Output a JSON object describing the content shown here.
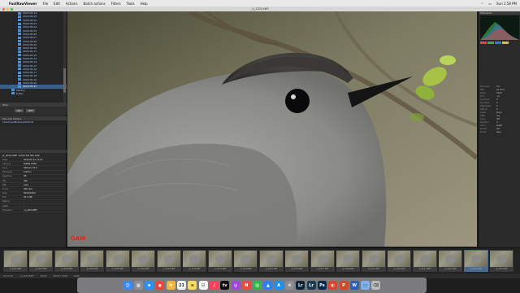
{
  "menubar": {
    "app": "FastRawViewer",
    "items": [
      "File",
      "Edit",
      "Actions",
      "Batch actions",
      "Filters",
      "Tools",
      "Help"
    ],
    "clock": "Sun 1:58 PM"
  },
  "window": {
    "title": "_II_2023.NEF"
  },
  "left_panel": {
    "folders": [
      "2020.04.14",
      "2020.04.18",
      "2020.05.02",
      "2020.05.03",
      "2020.05.04",
      "2020.05.05",
      "2020.05.06",
      "2020.05.07",
      "2020.05.08",
      "2020.05.09",
      "2020.05.10",
      "2020.05.11",
      "2020.05.12",
      "2020.05.13",
      "2020.05.14",
      "2020.05.15",
      "2020.05.16",
      "2020.05.17",
      "2020.05.18",
      "2020.05.19",
      "2020.05.20"
    ],
    "selected_folder": "2020.05.31",
    "libraries": [
      "Library",
      "Public"
    ],
    "strip_label": "Filter",
    "filter_buttons": [
      "ON",
      "OFF"
    ],
    "favorites_title": "Favorite folders",
    "favorite": "/Volumes/Photos/2020.05",
    "info_title": "_II_2023.NEF  1/250 f/8  ISO 400",
    "info_rows": [
      {
        "k": "Date",
        "v": "2020-05-31 13:22"
      },
      {
        "k": "Camera",
        "v": "NIKON D850"
      },
      {
        "k": "Lens",
        "v": "500mm f/5.6"
      },
      {
        "k": "Exposure",
        "v": "1/250 s"
      },
      {
        "k": "Aperture",
        "v": "f/8"
      },
      {
        "k": "ISO",
        "v": "400"
      },
      {
        "k": "WB",
        "v": "Auto"
      },
      {
        "k": "Focal",
        "v": "500 mm"
      },
      {
        "k": "Size",
        "v": "8256x5504"
      },
      {
        "k": "File",
        "v": "45.2 MB"
      },
      {
        "k": "Rating",
        "v": "-"
      },
      {
        "k": "Label",
        "v": "-"
      },
      {
        "k": "Filename",
        "v": "_II_2023.NEF"
      }
    ]
  },
  "viewer": {
    "watermark": "GAW"
  },
  "right_panel": {
    "hist_title": "Histogram",
    "meta": [
      {
        "k": "Exposure",
        "v": "0.0"
      },
      {
        "k": "WB",
        "v": "As Shot"
      },
      {
        "k": "Temp",
        "v": "5200"
      },
      {
        "k": "Tint",
        "v": "+4"
      },
      {
        "k": "Contrast",
        "v": "0"
      },
      {
        "k": "Shadows",
        "v": "0"
      },
      {
        "k": "Highlights",
        "v": "0"
      },
      {
        "k": "Rating",
        "v": "0"
      },
      {
        "k": "Label",
        "v": "None"
      },
      {
        "k": "XMP",
        "v": "Yes"
      },
      {
        "k": "Crop",
        "v": "Off"
      },
      {
        "k": "Rotation",
        "v": "0"
      },
      {
        "k": "Color",
        "v": "sRGB"
      },
      {
        "k": "Profile",
        "v": "Std"
      },
      {
        "k": "Mode",
        "v": "Raw"
      }
    ],
    "colors": [
      "#e04b3f",
      "#3fb049",
      "#3a74d8",
      "#d6c13a"
    ]
  },
  "filmstrip": {
    "thumbs": [
      "_II_2002.NEF",
      "_II_2003.NEF",
      "_II_2005.NEF",
      "_II_2006.NEF",
      "_II_2008.NEF",
      "_II_2009.NEF",
      "_II_2010.NEF",
      "_II_2012.NEF",
      "_II_2013.NEF",
      "_II_2014.NEF",
      "_II_2015.NEF",
      "_II_2016.NEF",
      "_II_2017.NEF",
      "_II_2018.NEF",
      "_II_2019.NEF",
      "_II_2020.NEF",
      "_II_2021.NEF",
      "_II_2022.NEF",
      "_II_2023.NEF",
      "_II_2024.NEF"
    ],
    "selected_index": 18
  },
  "statusbar": {
    "items": [
      "18 of 20",
      "_II_2023.NEF",
      "100%",
      "8256 x 5504",
      "RAW"
    ]
  },
  "dock": {
    "icons": [
      {
        "name": "finder-icon",
        "glyph": "☺",
        "color": "#3b8cf2"
      },
      {
        "name": "launchpad-icon",
        "glyph": "▦",
        "color": "#8d8d94"
      },
      {
        "name": "safari-icon",
        "glyph": "⊕",
        "color": "#2d8ff0"
      },
      {
        "name": "chrome-icon",
        "glyph": "◉",
        "color": "#e5473b"
      },
      {
        "name": "photos-icon",
        "glyph": "✿",
        "color": "#f2b63a"
      },
      {
        "name": "calendar-icon",
        "glyph": "21",
        "color": "#f3f3f3"
      },
      {
        "name": "notes-icon",
        "glyph": "≡",
        "color": "#f7dc5a"
      },
      {
        "name": "reminders-icon",
        "glyph": "☑",
        "color": "#f4f4f4"
      },
      {
        "name": "music-icon",
        "glyph": "♫",
        "color": "#fb3f5a"
      },
      {
        "name": "tv-icon",
        "glyph": "tv",
        "color": "#111111"
      },
      {
        "name": "podcasts-icon",
        "glyph": "◎",
        "color": "#a148d8"
      },
      {
        "name": "news-icon",
        "glyph": "N",
        "color": "#f0473f"
      },
      {
        "name": "numbers-icon",
        "glyph": "▥",
        "color": "#2fb84b"
      },
      {
        "name": "keynote-icon",
        "glyph": "▲",
        "color": "#2f7ef0"
      },
      {
        "name": "appstore-icon",
        "glyph": "A",
        "color": "#1e8ff2"
      },
      {
        "name": "settings-icon",
        "glyph": "⚙",
        "color": "#8c8c90"
      },
      {
        "name": "lightroom-icon",
        "glyph": "Lr",
        "color": "#0d2537"
      },
      {
        "name": "lightroom-classic-icon",
        "glyph": "Lr",
        "color": "#1b3a52"
      },
      {
        "name": "photoshop-icon",
        "glyph": "Ps",
        "color": "#0a2a4a"
      },
      {
        "name": "fastrawviewer-icon",
        "glyph": "◐",
        "color": "#d5462f"
      },
      {
        "name": "powerpoint-icon",
        "glyph": "P",
        "color": "#d04a2a"
      },
      {
        "name": "word-icon",
        "glyph": "W",
        "color": "#2b5fb5"
      },
      {
        "name": "folder-icon",
        "glyph": "▭",
        "color": "#7fb0e8"
      },
      {
        "name": "trash-icon",
        "glyph": "⌫",
        "color": "#b9b9bd"
      }
    ]
  }
}
